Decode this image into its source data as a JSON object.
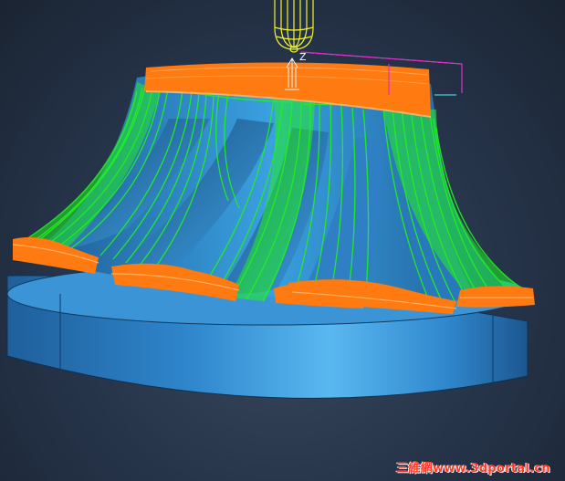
{
  "viewport": {
    "axis_label": "Z",
    "watermark": "三維網www.3dportal.cn"
  },
  "colors": {
    "background": "#26344a",
    "stock_base": "#2f7fc4",
    "hub": "#3a9ad8",
    "toolpath_green": "#22ee22",
    "toolpath_orange": "#ff7a10",
    "tool_yellow": "#f2f230",
    "marker_magenta": "#e030c8",
    "watermark_red": "#ff3a2a"
  },
  "icons": {
    "tool": "ball-end-cutter-icon",
    "axis": "z-axis-triad-icon"
  }
}
